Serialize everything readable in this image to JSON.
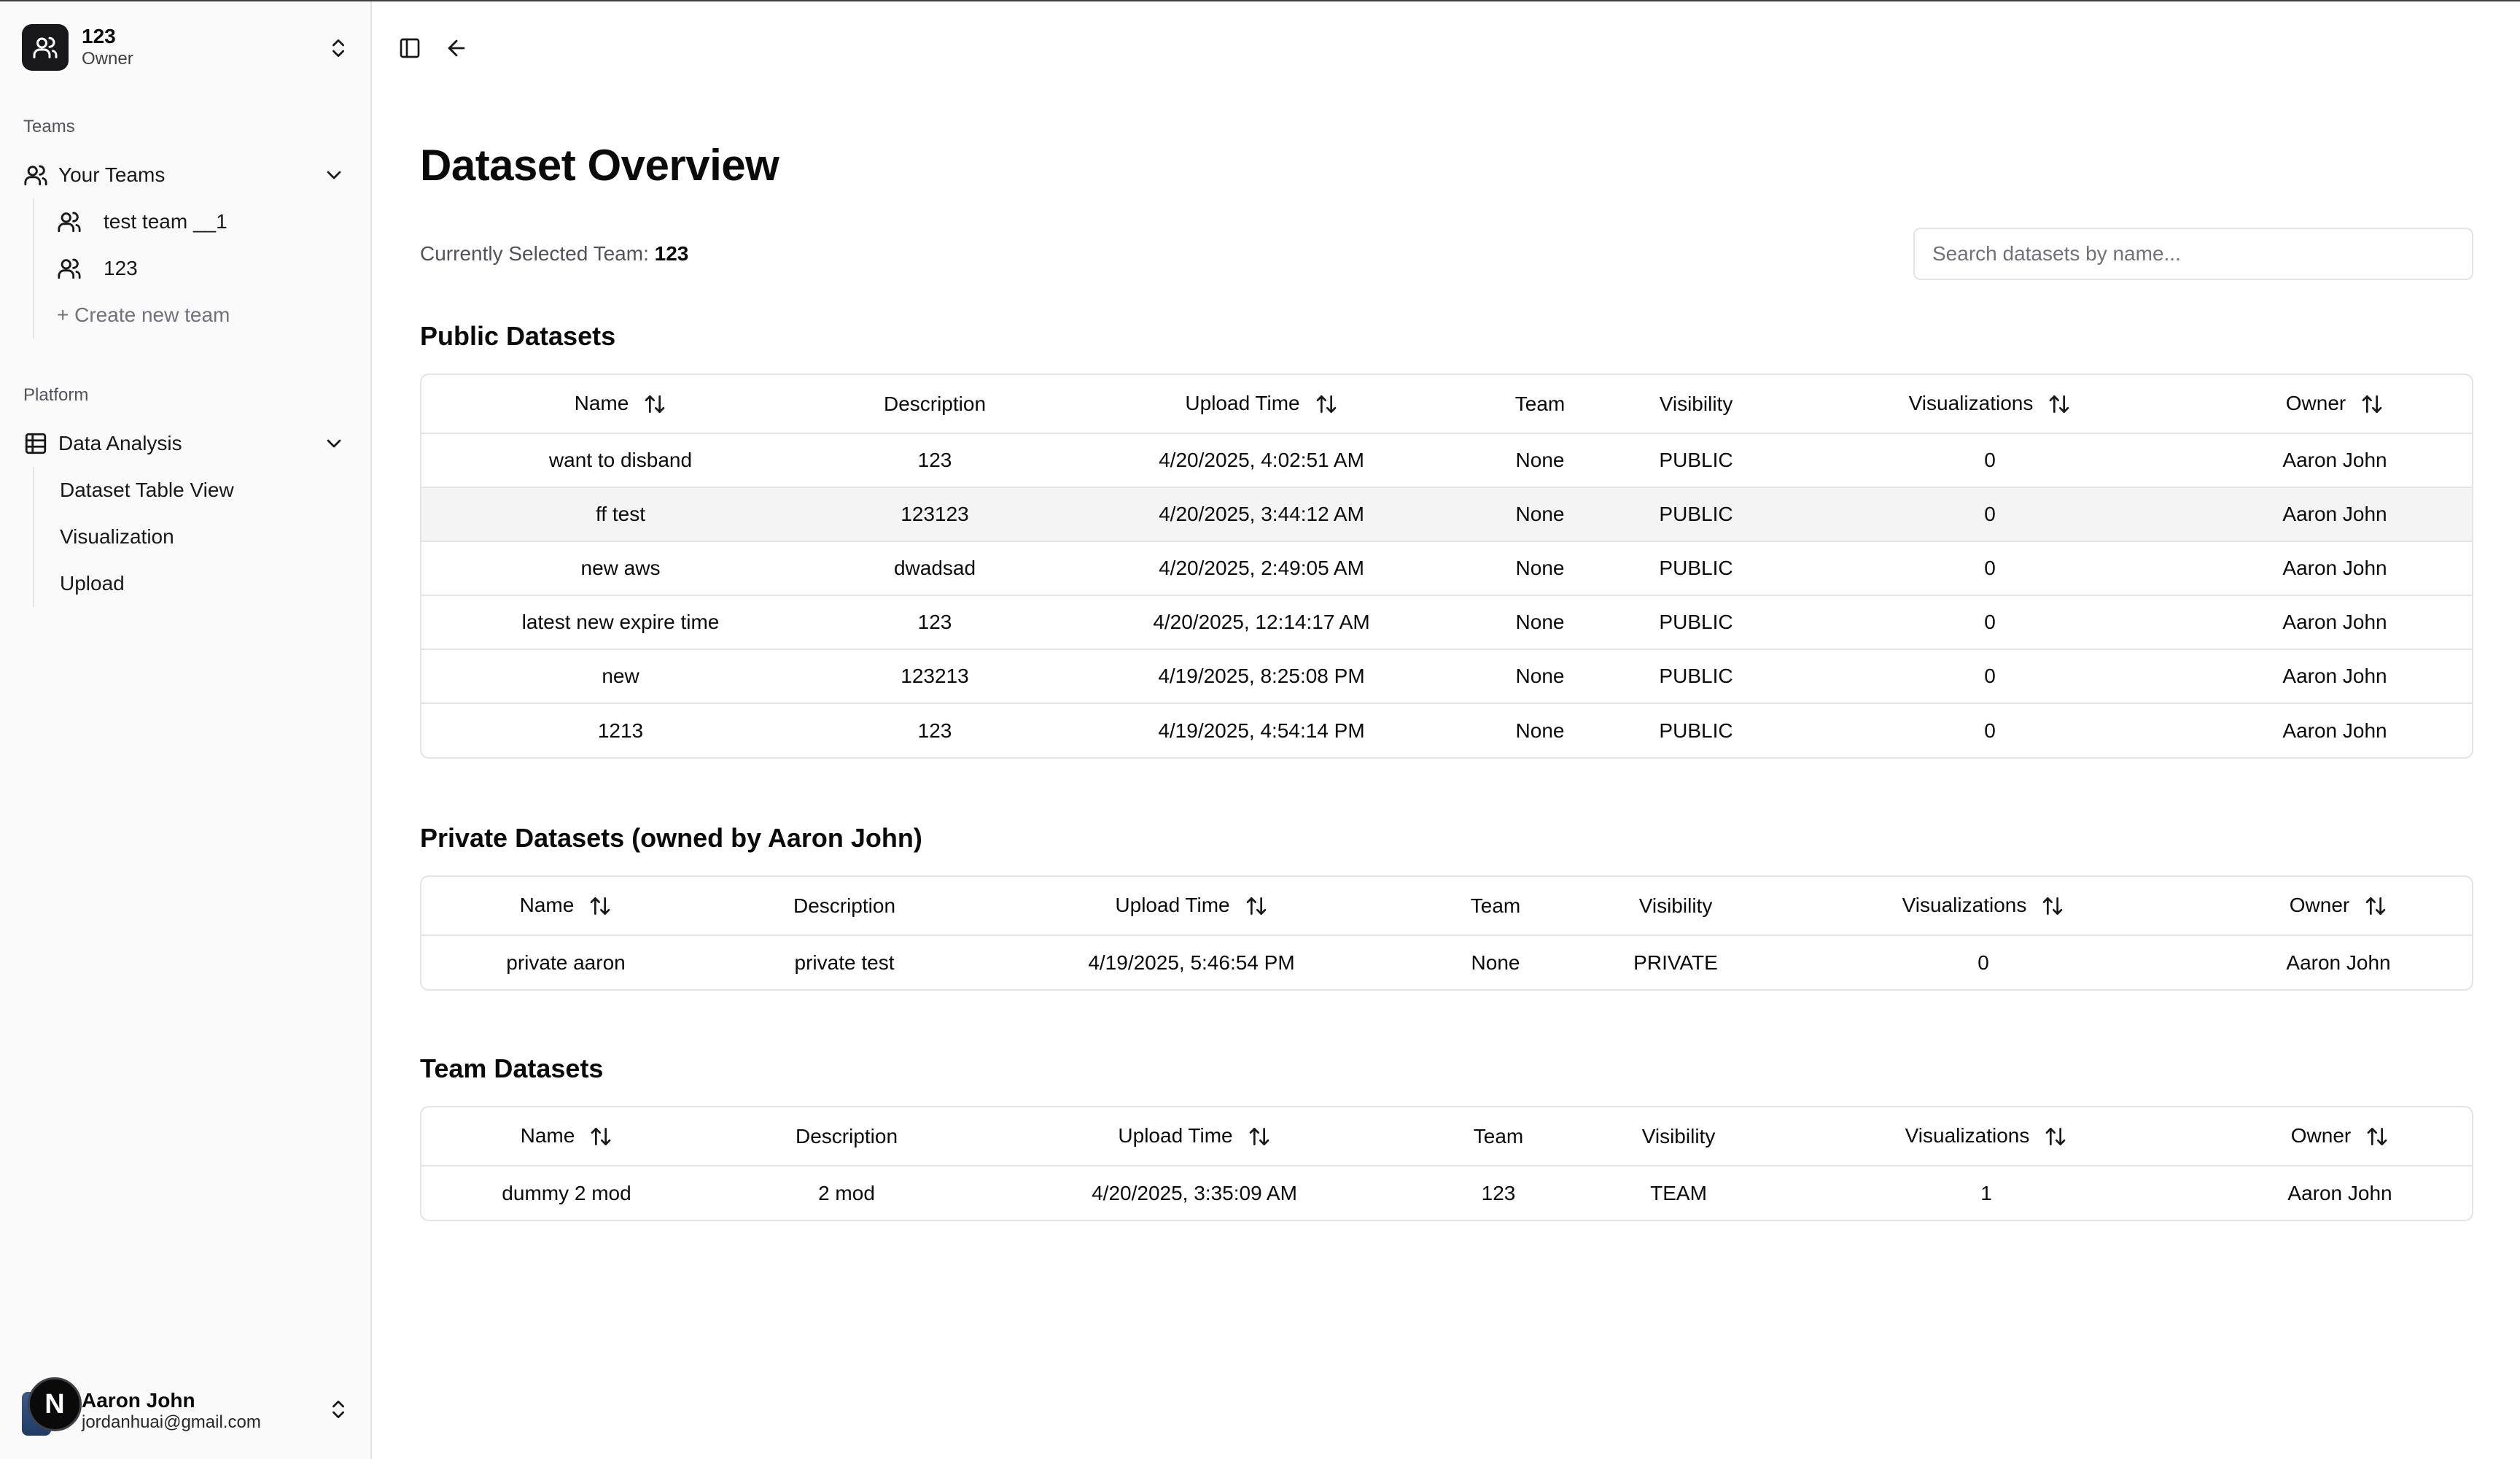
{
  "sidebar": {
    "team": {
      "name": "123",
      "role": "Owner"
    },
    "teams_label": "Teams",
    "your_teams": "Your Teams",
    "team_items": [
      {
        "label": "test team __1"
      },
      {
        "label": "123"
      }
    ],
    "create_team": "+ Create new team",
    "platform_label": "Platform",
    "data_analysis": "Data Analysis",
    "platform_items": [
      {
        "label": "Dataset Table View"
      },
      {
        "label": "Visualization"
      },
      {
        "label": "Upload"
      }
    ],
    "user": {
      "avatar": "N",
      "name": "Aaron John",
      "email": "jordanhuai@gmail.com"
    }
  },
  "header": {
    "title": "Dataset Overview",
    "selected_team_label": "Currently Selected Team:",
    "selected_team_value": "123",
    "search_placeholder": "Search datasets by name..."
  },
  "columns": [
    "Name",
    "Description",
    "Upload Time",
    "Team",
    "Visibility",
    "Visualizations",
    "Owner"
  ],
  "public": {
    "title": "Public Datasets",
    "rows": [
      [
        "want to disband",
        "123",
        "4/20/2025, 4:02:51 AM",
        "None",
        "PUBLIC",
        "0",
        "Aaron John"
      ],
      [
        "ff test",
        "123123",
        "4/20/2025, 3:44:12 AM",
        "None",
        "PUBLIC",
        "0",
        "Aaron John"
      ],
      [
        "new aws",
        "dwadsad",
        "4/20/2025, 2:49:05 AM",
        "None",
        "PUBLIC",
        "0",
        "Aaron John"
      ],
      [
        "latest new expire time",
        "123",
        "4/20/2025, 12:14:17 AM",
        "None",
        "PUBLIC",
        "0",
        "Aaron John"
      ],
      [
        "new",
        "123213",
        "4/19/2025, 8:25:08 PM",
        "None",
        "PUBLIC",
        "0",
        "Aaron John"
      ],
      [
        "1213",
        "123",
        "4/19/2025, 4:54:14 PM",
        "None",
        "PUBLIC",
        "0",
        "Aaron John"
      ]
    ]
  },
  "private": {
    "title": "Private Datasets (owned by Aaron John)",
    "rows": [
      [
        "private aaron",
        "private test",
        "4/19/2025, 5:46:54 PM",
        "None",
        "PRIVATE",
        "0",
        "Aaron John"
      ]
    ]
  },
  "team": {
    "title": "Team Datasets",
    "rows": [
      [
        "dummy 2 mod",
        "2 mod",
        "4/20/2025, 3:35:09 AM",
        "123",
        "TEAM",
        "1",
        "Aaron John"
      ]
    ]
  },
  "icons": {
    "team": "users-icon",
    "platform": "table-icon",
    "sort": "sort-arrows-icon",
    "toggle": "sidebar-toggle-icon",
    "back": "arrow-left-icon"
  },
  "colors": {
    "border": "#e4e4e7",
    "muted": "#71717a",
    "row_highlight": "#f4f4f5"
  }
}
